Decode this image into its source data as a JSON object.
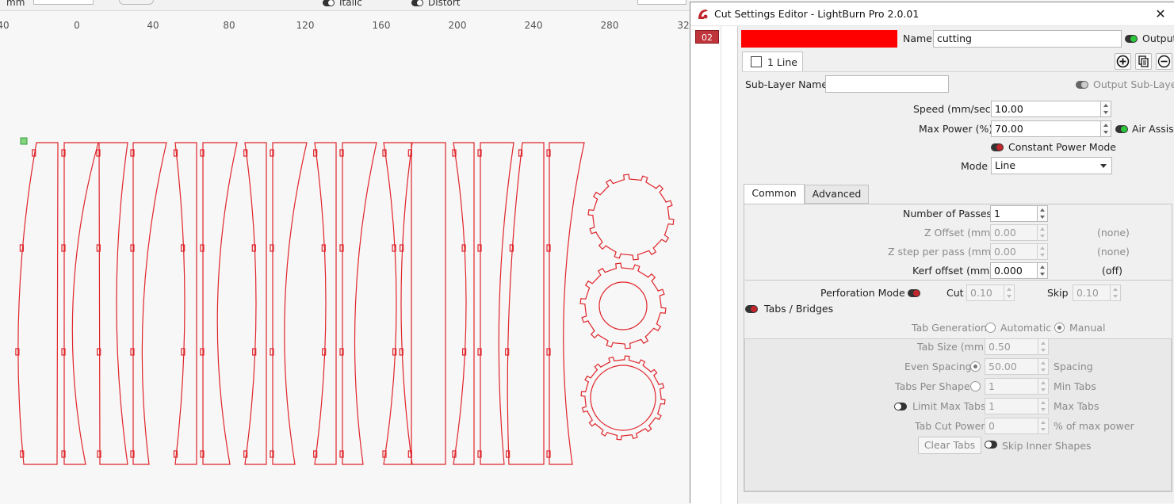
{
  "toolbar": {
    "italic_label": "Italic",
    "distort_label": "Distort"
  },
  "ruler": {
    "labels": [
      "40",
      "0",
      "40",
      "80",
      "120",
      "160",
      "200",
      "240",
      "280",
      "32"
    ]
  },
  "dialog": {
    "title": "Cut Settings Editor - LightBurn Pro 2.0.01",
    "close_icon": "close-icon",
    "layer_number": "02",
    "layer_color": "#ff0000",
    "name_label": "Name",
    "name_value": "cutting",
    "output_label": "Output",
    "sublayer_tab_label": "1 Line",
    "sublayer_name_label": "Sub-Layer Name",
    "sublayer_name_value": "",
    "output_sublayer_label": "Output Sub-Layer",
    "speed_label": "Speed (mm/sec)",
    "speed_value": "10.00",
    "max_power_label": "Max Power (%)",
    "max_power_value": "70.00",
    "air_assist_label": "Air Assist",
    "constant_power_label": "Constant Power Mode",
    "mode_label": "Mode",
    "mode_value": "Line",
    "tabs": [
      "Common",
      "Advanced"
    ],
    "passes_label": "Number of Passes",
    "passes_value": "1",
    "z_offset_label": "Z Offset (mm)",
    "z_offset_value": "0.00",
    "z_offset_note": "(none)",
    "z_step_label": "Z step per pass (mm)",
    "z_step_value": "0.00",
    "z_step_note": "(none)",
    "kerf_label": "Kerf offset (mm)",
    "kerf_value": "0.000",
    "kerf_note": "(off)",
    "perforation_label": "Perforation Mode",
    "cut_label": "Cut",
    "cut_value": "0.10",
    "skip_label": "Skip",
    "skip_value": "0.10",
    "tabs_bridges_label": "Tabs / Bridges",
    "tab_generation_label": "Tab Generation",
    "automatic_label": "Automatic",
    "manual_label": "Manual",
    "tab_size_label": "Tab Size (mm)",
    "tab_size_value": "0.50",
    "even_spacing_label": "Even Spacing",
    "even_spacing_value": "50.00",
    "spacing_label": "Spacing",
    "tabs_per_shape_label": "Tabs Per Shape",
    "tabs_per_shape_value": "1",
    "min_tabs_label": "Min Tabs",
    "limit_max_tabs_label": "Limit Max Tabs",
    "limit_max_tabs_value": "1",
    "max_tabs_label": "Max Tabs",
    "tab_cut_power_label": "Tab Cut Power",
    "tab_cut_power_value": "0",
    "pct_max_power_label": "% of max power",
    "clear_tabs_label": "Clear Tabs",
    "skip_inner_label": "Skip Inner Shapes"
  },
  "colors": {
    "cut_line": "#e0242a",
    "accent_green": "#2cc63b",
    "layer_badge": "#c0343b"
  }
}
